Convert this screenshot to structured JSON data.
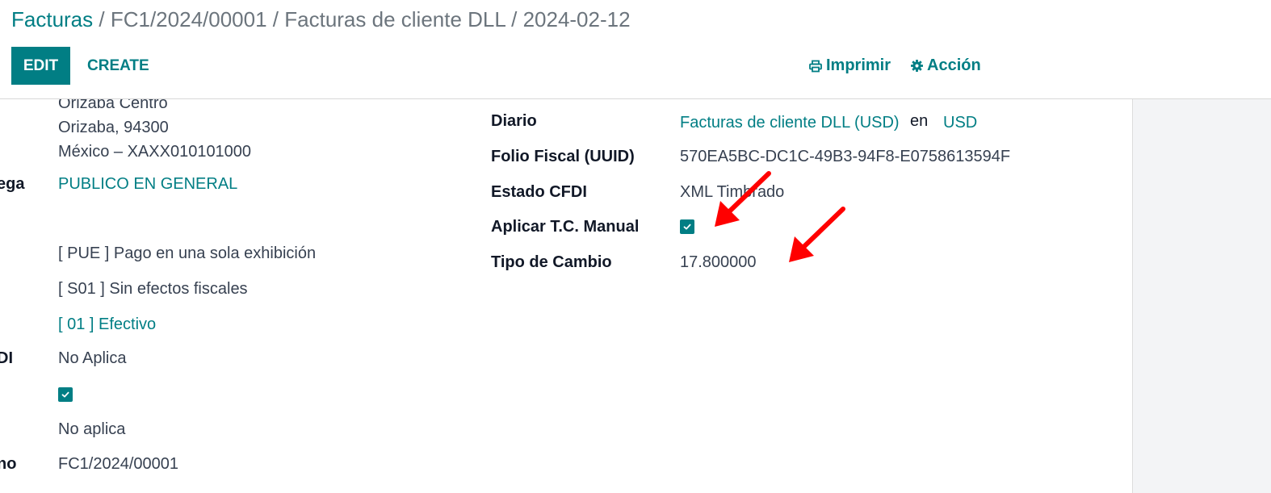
{
  "breadcrumb": {
    "items": [
      "Facturas",
      "FC1/2024/00001",
      "Facturas de cliente DLL",
      "2024-02-12"
    ],
    "separator": "/"
  },
  "toolbar": {
    "edit_label": "EDIT",
    "create_label": "CREATE",
    "print_label": "Imprimir",
    "print_icon": "printer-icon",
    "action_label": "Acción",
    "action_icon": "gear-icon"
  },
  "left_column": {
    "address_line1": "Orizaba Centro",
    "address_line2": "Orizaba, 94300",
    "address_line3": "México – XAXX010101000",
    "delivery_label_fragment": "ega",
    "delivery_value": "PUBLICO EN GENERAL",
    "payment_method": "[ PUE ] Pago en una sola exhibición",
    "cfdi_use": "[ S01 ] Sin efectos fiscales",
    "payment_form": "[ 01 ] Efectivo",
    "cfdi_label_fragment": "DI",
    "cfdi_relation_value": "No Aplica",
    "checkbox_checked": true,
    "export_value": "No aplica",
    "reference_label_fragment": "no",
    "reference_value": "FC1/2024/00001"
  },
  "right_column": {
    "diario_label": "Diario",
    "diario_value": "Facturas de cliente DLL (USD)",
    "diario_in": "en",
    "diario_currency": "USD",
    "uuid_label": "Folio Fiscal (UUID)",
    "uuid_value": "570EA5BC-DC1C-49B3-94F8-E0758613594F",
    "estado_label": "Estado CFDI",
    "estado_value": "XML Timbrado",
    "manual_tc_label": "Aplicar T.C. Manual",
    "manual_tc_checked": true,
    "tipo_cambio_label": "Tipo de Cambio",
    "tipo_cambio_value": "17.800000"
  },
  "colors": {
    "accent": "#017e84",
    "annotation_arrow": "#ff0000"
  }
}
